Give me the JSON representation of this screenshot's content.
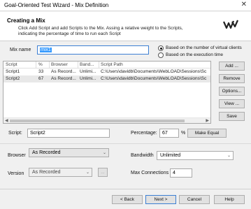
{
  "window": {
    "title": "Goal-Oriented Test Wizard - Mix Definition",
    "close_glyph": "✕"
  },
  "header": {
    "title": "Creating a Mix",
    "description": "Click Add Script and add Scripts to the Mix. Assing a relative weight to the Scripts, indicating the percentage of time to run each Script"
  },
  "mix": {
    "name_label": "Mix name",
    "name_value": "mix1",
    "radio_clients": "Based on the number of virtual clients",
    "radio_execution": "Based on the execution time"
  },
  "table": {
    "columns": [
      "Script",
      "%",
      "Browser",
      "Band...",
      "Script Path"
    ],
    "rows": [
      [
        "Script1",
        "33",
        "As Record...",
        "Unlimi...",
        "C:\\Users\\davidb\\Documents\\WebLOAD\\Sessions\\Sc"
      ],
      [
        "Script2",
        "67",
        "As Record...",
        "Unlimi...",
        "C:\\Users\\davidb\\Documents\\WebLOAD\\Sessions\\Sc"
      ]
    ]
  },
  "side_buttons": {
    "add": "Add ...",
    "remove": "Remove",
    "options": "Options...",
    "view": "View ...",
    "save": "Save"
  },
  "details": {
    "script_label": "Script:",
    "script_value": "Script2",
    "percentage_label": "Percentage:",
    "percentage_value": "67",
    "percent_sign": "%",
    "make_equal": "Make Equal",
    "browser_label": "Browser",
    "browser_value": "As Recorded",
    "bandwidth_label": "Bandwidth",
    "bandwidth_value": "Unlimited",
    "version_label": "Version",
    "version_value": "As Recorded",
    "ellipsis_button": "...",
    "max_connections_label": "Max Connections",
    "max_connections_value": "4"
  },
  "footer": {
    "back": "< Back",
    "next": "Next >",
    "cancel": "Cancel",
    "help": "Help"
  },
  "colors": {
    "accent": "#3c7fd3",
    "selection": "#3399ff"
  }
}
